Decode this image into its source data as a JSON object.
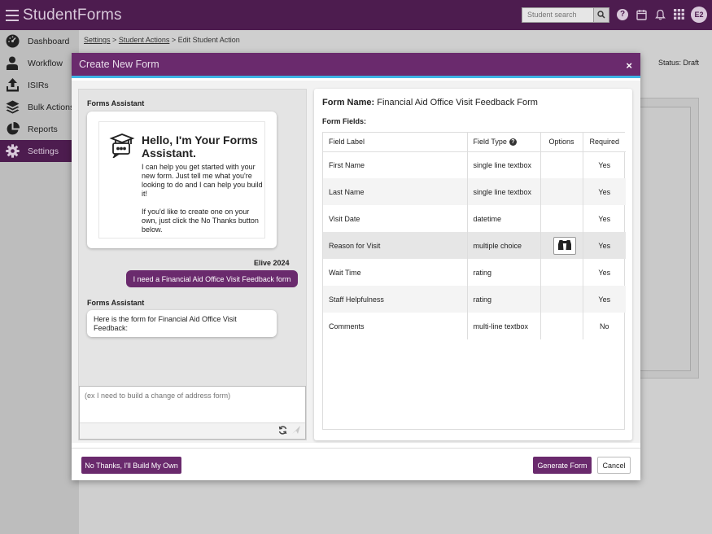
{
  "app": {
    "brand": "StudentForms",
    "avatar_initials": "E2"
  },
  "header": {
    "search_placeholder": "Student search",
    "help_label": "?"
  },
  "sidebar": {
    "items": [
      {
        "label": "Dashboard",
        "icon": "dashboard-icon"
      },
      {
        "label": "Workflow",
        "icon": "person-icon"
      },
      {
        "label": "ISIRs",
        "icon": "upload-icon"
      },
      {
        "label": "Bulk Actions",
        "icon": "layers-icon"
      },
      {
        "label": "Reports",
        "icon": "pie-chart-icon"
      },
      {
        "label": "Settings",
        "icon": "gear-icon",
        "active": true
      }
    ]
  },
  "breadcrumb": {
    "item1": "Settings",
    "item2": "Student Actions",
    "current": "Edit Student Action",
    "sep": ">"
  },
  "background": {
    "status": "Status: Draft"
  },
  "modal": {
    "title": "Create New Form",
    "close": "×",
    "chat": {
      "assistant_label": "Forms Assistant",
      "hello": "Hello, I'm Your Forms Assistant.",
      "intro1": "I can help you get started with your new form. Just tell me what you're looking to do and I can help you build it!",
      "intro2": "If you'd like to create one on your own, just click the No Thanks button below.",
      "user_name": "Elive 2024",
      "user_message": "I need a Financial Aid Office Visit Feedback form",
      "assistant_label2": "Forms Assistant",
      "reply": "Here is the form for Financial Aid Office Visit Feedback:",
      "input_placeholder": "(ex I need to build a change of address form)"
    },
    "form": {
      "name_label": "Form Name:",
      "name_value": "Financial Aid Office Visit Feedback Form",
      "fields_label": "Form Fields:",
      "columns": {
        "label": "Field Label",
        "type": "Field Type",
        "options": "Options",
        "required": "Required"
      },
      "rows": [
        {
          "label": "First Name",
          "type": "single line textbox",
          "required": "Yes"
        },
        {
          "label": "Last Name",
          "type": "single line textbox",
          "required": "Yes"
        },
        {
          "label": "Visit Date",
          "type": "datetime",
          "required": "Yes"
        },
        {
          "label": "Reason for Visit",
          "type": "multiple choice",
          "required": "Yes",
          "has_options": true
        },
        {
          "label": "Wait Time",
          "type": "rating",
          "required": "Yes"
        },
        {
          "label": "Staff Helpfulness",
          "type": "rating",
          "required": "Yes"
        },
        {
          "label": "Comments",
          "type": "multi-line textbox",
          "required": "No"
        }
      ]
    },
    "footer": {
      "no_thanks": "No Thanks, I'll Build My Own",
      "generate": "Generate Form",
      "cancel": "Cancel"
    }
  }
}
